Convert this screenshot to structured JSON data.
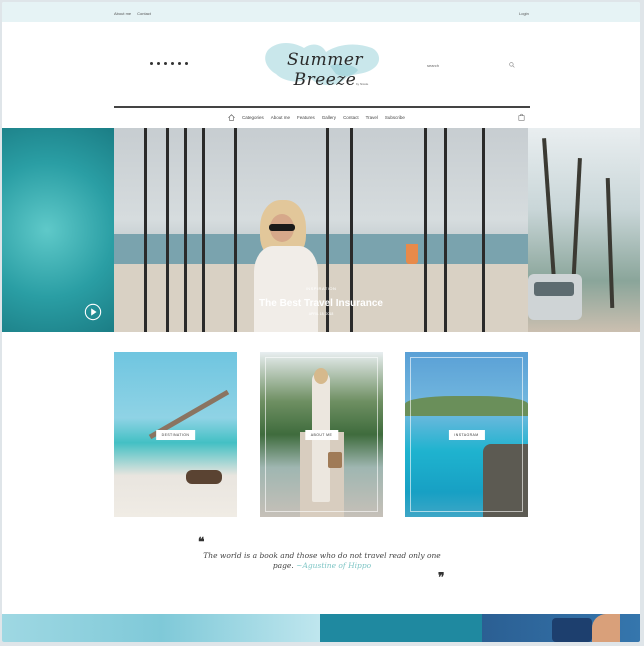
{
  "topbar": {
    "links": [
      "About me",
      "Contact"
    ],
    "login": "Login"
  },
  "header": {
    "logo_text": "Summer Breeze",
    "logo_sub": "by Nicole",
    "search_placeholder": "search",
    "social_icons": [
      "facebook-icon",
      "twitter-icon",
      "youtube-icon",
      "instagram-icon",
      "pinterest-icon",
      "rss-icon"
    ]
  },
  "nav": {
    "items": [
      "Categories",
      "About me",
      "Features",
      "Gallery",
      "Contact",
      "Travel",
      "Subscribe"
    ]
  },
  "hero": {
    "badge": "INSPIRATION",
    "title": "The Best Travel Insurance",
    "date": "APRIL 18, 2018"
  },
  "cards": [
    {
      "label": "DESTINATION"
    },
    {
      "label": "ABOUT ME"
    },
    {
      "label": "INSTAGRAM"
    }
  ],
  "quote": {
    "text": "The world is a book and those who do not travel read only one page.",
    "author": "~Agustine of Hippo"
  },
  "colors": {
    "accent": "#7fc6c6",
    "topbar": "#e6f3f5"
  }
}
